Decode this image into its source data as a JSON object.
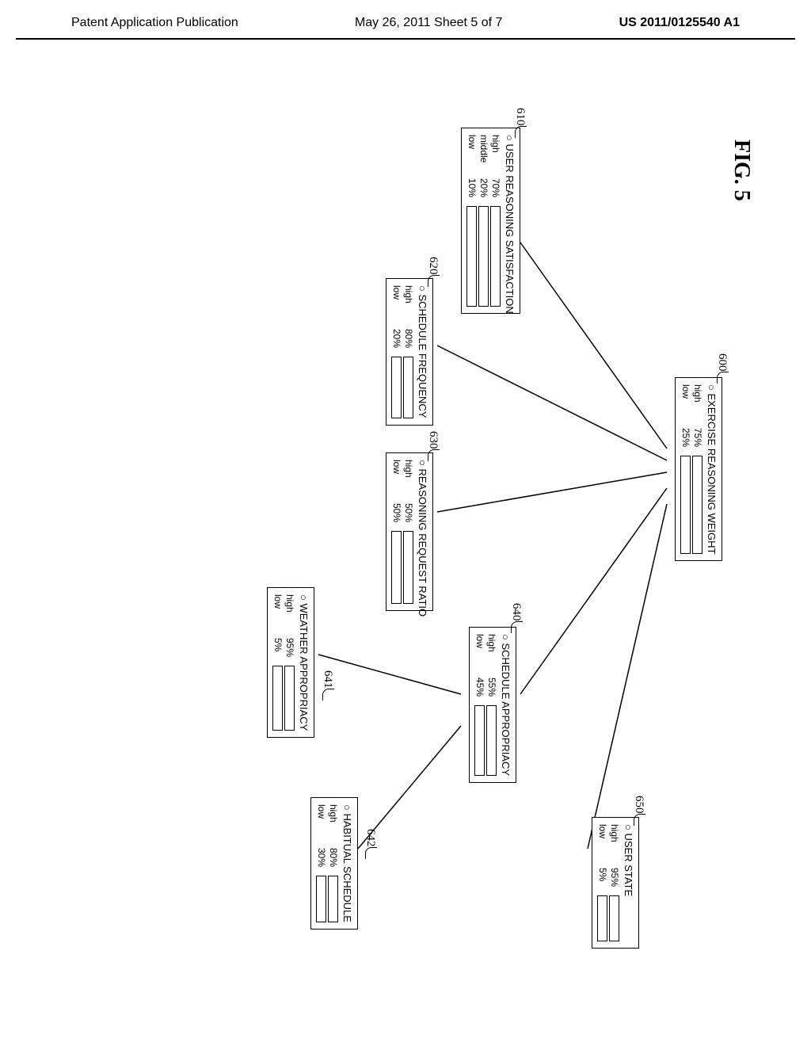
{
  "header": {
    "left": "Patent Application Publication",
    "center": "May 26, 2011  Sheet 5 of 7",
    "right": "US 2011/0125540 A1"
  },
  "fig_label": "FIG. 5",
  "nodes": {
    "root": {
      "ref": "600",
      "title": "EXERCISE REASONING WEIGHT",
      "rows": [
        {
          "label": "high",
          "pct": "75%",
          "val": 75
        },
        {
          "label": "low",
          "pct": "25%",
          "val": 25
        }
      ]
    },
    "n610": {
      "ref": "610",
      "title": "USER REASONING SATISFACTION",
      "rows": [
        {
          "label": "high",
          "pct": "70%",
          "val": 70
        },
        {
          "label": "middle",
          "pct": "20%",
          "val": 20,
          "hatch": true
        },
        {
          "label": "low",
          "pct": "10%",
          "val": 10
        }
      ]
    },
    "n620": {
      "ref": "620",
      "title": "SCHEDULE FREQUENCY",
      "rows": [
        {
          "label": "high",
          "pct": "80%",
          "val": 80
        },
        {
          "label": "low",
          "pct": "20%",
          "val": 20
        }
      ]
    },
    "n630": {
      "ref": "630",
      "title": "REASONING REQUEST RATIO",
      "rows": [
        {
          "label": "high",
          "pct": "50%",
          "val": 50
        },
        {
          "label": "low",
          "pct": "50%",
          "val": 50
        }
      ]
    },
    "n640": {
      "ref": "640",
      "title": "SCHEDULE APPROPRIACY",
      "rows": [
        {
          "label": "high",
          "pct": "55%",
          "val": 55
        },
        {
          "label": "low",
          "pct": "45%",
          "val": 45
        }
      ]
    },
    "n650": {
      "ref": "650",
      "title": "USER STATE",
      "rows": [
        {
          "label": "high",
          "pct": "95%",
          "val": 95
        },
        {
          "label": "low",
          "pct": "5%",
          "val": 5
        }
      ]
    },
    "n641": {
      "ref": "641",
      "title": "WEATHER APPROPRIACY",
      "rows": [
        {
          "label": "high",
          "pct": "95%",
          "val": 95
        },
        {
          "label": "low",
          "pct": "5%",
          "val": 5
        }
      ]
    },
    "n642": {
      "ref": "642",
      "title": "HABITUAL SCHEDULE",
      "rows": [
        {
          "label": "high",
          "pct": "80%",
          "val": 80
        },
        {
          "label": "low",
          "pct": "30%",
          "val": 30
        }
      ]
    }
  },
  "chart_data": {
    "type": "bar",
    "note": "Bayesian network / probability tree. Each node has categorical probability bars.",
    "edges": [
      [
        "600",
        "610"
      ],
      [
        "600",
        "620"
      ],
      [
        "600",
        "630"
      ],
      [
        "600",
        "640"
      ],
      [
        "600",
        "650"
      ],
      [
        "640",
        "641"
      ],
      [
        "640",
        "642"
      ]
    ],
    "nodes": {
      "600": {
        "title": "EXERCISE REASONING WEIGHT",
        "high": 75,
        "low": 25
      },
      "610": {
        "title": "USER REASONING SATISFACTION",
        "high": 70,
        "middle": 20,
        "low": 10
      },
      "620": {
        "title": "SCHEDULE FREQUENCY",
        "high": 80,
        "low": 20
      },
      "630": {
        "title": "REASONING REQUEST RATIO",
        "high": 50,
        "low": 50
      },
      "640": {
        "title": "SCHEDULE APPROPRIACY",
        "high": 55,
        "low": 45
      },
      "650": {
        "title": "USER STATE",
        "high": 95,
        "low": 5
      },
      "641": {
        "title": "WEATHER APPROPRIACY",
        "high": 95,
        "low": 5
      },
      "642": {
        "title": "HABITUAL SCHEDULE",
        "high": 80,
        "low": 30
      }
    }
  }
}
